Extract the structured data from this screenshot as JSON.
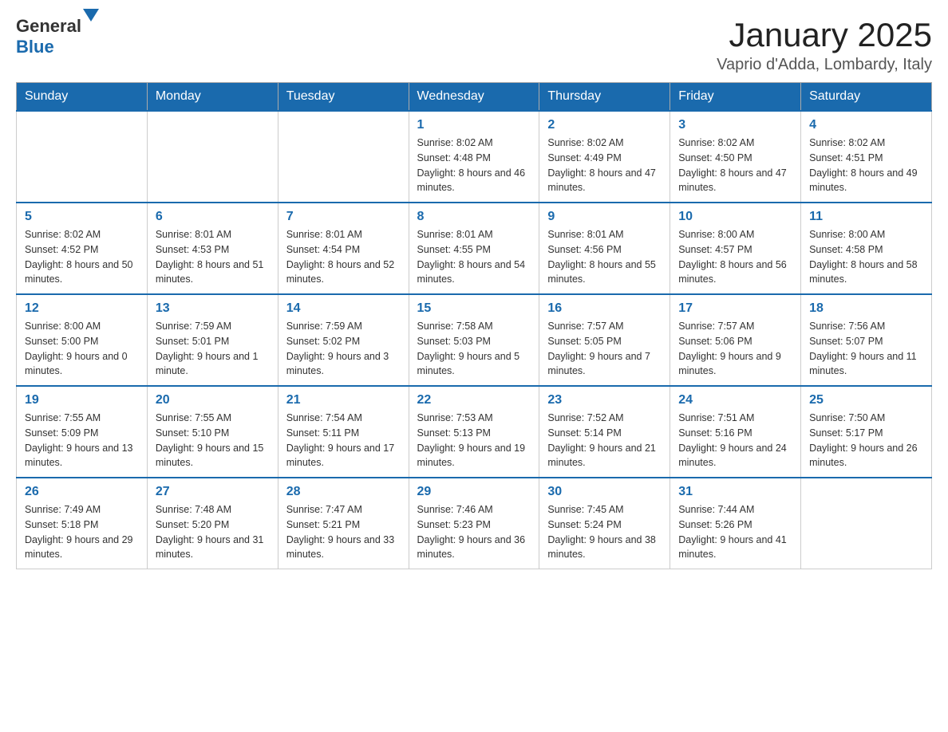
{
  "header": {
    "logo": {
      "general": "General",
      "blue": "Blue"
    },
    "title": "January 2025",
    "location": "Vaprio d'Adda, Lombardy, Italy"
  },
  "days_of_week": [
    "Sunday",
    "Monday",
    "Tuesday",
    "Wednesday",
    "Thursday",
    "Friday",
    "Saturday"
  ],
  "weeks": [
    [
      {
        "day": "",
        "sunrise": "",
        "sunset": "",
        "daylight": ""
      },
      {
        "day": "",
        "sunrise": "",
        "sunset": "",
        "daylight": ""
      },
      {
        "day": "",
        "sunrise": "",
        "sunset": "",
        "daylight": ""
      },
      {
        "day": "1",
        "sunrise": "Sunrise: 8:02 AM",
        "sunset": "Sunset: 4:48 PM",
        "daylight": "Daylight: 8 hours and 46 minutes."
      },
      {
        "day": "2",
        "sunrise": "Sunrise: 8:02 AM",
        "sunset": "Sunset: 4:49 PM",
        "daylight": "Daylight: 8 hours and 47 minutes."
      },
      {
        "day": "3",
        "sunrise": "Sunrise: 8:02 AM",
        "sunset": "Sunset: 4:50 PM",
        "daylight": "Daylight: 8 hours and 47 minutes."
      },
      {
        "day": "4",
        "sunrise": "Sunrise: 8:02 AM",
        "sunset": "Sunset: 4:51 PM",
        "daylight": "Daylight: 8 hours and 49 minutes."
      }
    ],
    [
      {
        "day": "5",
        "sunrise": "Sunrise: 8:02 AM",
        "sunset": "Sunset: 4:52 PM",
        "daylight": "Daylight: 8 hours and 50 minutes."
      },
      {
        "day": "6",
        "sunrise": "Sunrise: 8:01 AM",
        "sunset": "Sunset: 4:53 PM",
        "daylight": "Daylight: 8 hours and 51 minutes."
      },
      {
        "day": "7",
        "sunrise": "Sunrise: 8:01 AM",
        "sunset": "Sunset: 4:54 PM",
        "daylight": "Daylight: 8 hours and 52 minutes."
      },
      {
        "day": "8",
        "sunrise": "Sunrise: 8:01 AM",
        "sunset": "Sunset: 4:55 PM",
        "daylight": "Daylight: 8 hours and 54 minutes."
      },
      {
        "day": "9",
        "sunrise": "Sunrise: 8:01 AM",
        "sunset": "Sunset: 4:56 PM",
        "daylight": "Daylight: 8 hours and 55 minutes."
      },
      {
        "day": "10",
        "sunrise": "Sunrise: 8:00 AM",
        "sunset": "Sunset: 4:57 PM",
        "daylight": "Daylight: 8 hours and 56 minutes."
      },
      {
        "day": "11",
        "sunrise": "Sunrise: 8:00 AM",
        "sunset": "Sunset: 4:58 PM",
        "daylight": "Daylight: 8 hours and 58 minutes."
      }
    ],
    [
      {
        "day": "12",
        "sunrise": "Sunrise: 8:00 AM",
        "sunset": "Sunset: 5:00 PM",
        "daylight": "Daylight: 9 hours and 0 minutes."
      },
      {
        "day": "13",
        "sunrise": "Sunrise: 7:59 AM",
        "sunset": "Sunset: 5:01 PM",
        "daylight": "Daylight: 9 hours and 1 minute."
      },
      {
        "day": "14",
        "sunrise": "Sunrise: 7:59 AM",
        "sunset": "Sunset: 5:02 PM",
        "daylight": "Daylight: 9 hours and 3 minutes."
      },
      {
        "day": "15",
        "sunrise": "Sunrise: 7:58 AM",
        "sunset": "Sunset: 5:03 PM",
        "daylight": "Daylight: 9 hours and 5 minutes."
      },
      {
        "day": "16",
        "sunrise": "Sunrise: 7:57 AM",
        "sunset": "Sunset: 5:05 PM",
        "daylight": "Daylight: 9 hours and 7 minutes."
      },
      {
        "day": "17",
        "sunrise": "Sunrise: 7:57 AM",
        "sunset": "Sunset: 5:06 PM",
        "daylight": "Daylight: 9 hours and 9 minutes."
      },
      {
        "day": "18",
        "sunrise": "Sunrise: 7:56 AM",
        "sunset": "Sunset: 5:07 PM",
        "daylight": "Daylight: 9 hours and 11 minutes."
      }
    ],
    [
      {
        "day": "19",
        "sunrise": "Sunrise: 7:55 AM",
        "sunset": "Sunset: 5:09 PM",
        "daylight": "Daylight: 9 hours and 13 minutes."
      },
      {
        "day": "20",
        "sunrise": "Sunrise: 7:55 AM",
        "sunset": "Sunset: 5:10 PM",
        "daylight": "Daylight: 9 hours and 15 minutes."
      },
      {
        "day": "21",
        "sunrise": "Sunrise: 7:54 AM",
        "sunset": "Sunset: 5:11 PM",
        "daylight": "Daylight: 9 hours and 17 minutes."
      },
      {
        "day": "22",
        "sunrise": "Sunrise: 7:53 AM",
        "sunset": "Sunset: 5:13 PM",
        "daylight": "Daylight: 9 hours and 19 minutes."
      },
      {
        "day": "23",
        "sunrise": "Sunrise: 7:52 AM",
        "sunset": "Sunset: 5:14 PM",
        "daylight": "Daylight: 9 hours and 21 minutes."
      },
      {
        "day": "24",
        "sunrise": "Sunrise: 7:51 AM",
        "sunset": "Sunset: 5:16 PM",
        "daylight": "Daylight: 9 hours and 24 minutes."
      },
      {
        "day": "25",
        "sunrise": "Sunrise: 7:50 AM",
        "sunset": "Sunset: 5:17 PM",
        "daylight": "Daylight: 9 hours and 26 minutes."
      }
    ],
    [
      {
        "day": "26",
        "sunrise": "Sunrise: 7:49 AM",
        "sunset": "Sunset: 5:18 PM",
        "daylight": "Daylight: 9 hours and 29 minutes."
      },
      {
        "day": "27",
        "sunrise": "Sunrise: 7:48 AM",
        "sunset": "Sunset: 5:20 PM",
        "daylight": "Daylight: 9 hours and 31 minutes."
      },
      {
        "day": "28",
        "sunrise": "Sunrise: 7:47 AM",
        "sunset": "Sunset: 5:21 PM",
        "daylight": "Daylight: 9 hours and 33 minutes."
      },
      {
        "day": "29",
        "sunrise": "Sunrise: 7:46 AM",
        "sunset": "Sunset: 5:23 PM",
        "daylight": "Daylight: 9 hours and 36 minutes."
      },
      {
        "day": "30",
        "sunrise": "Sunrise: 7:45 AM",
        "sunset": "Sunset: 5:24 PM",
        "daylight": "Daylight: 9 hours and 38 minutes."
      },
      {
        "day": "31",
        "sunrise": "Sunrise: 7:44 AM",
        "sunset": "Sunset: 5:26 PM",
        "daylight": "Daylight: 9 hours and 41 minutes."
      },
      {
        "day": "",
        "sunrise": "",
        "sunset": "",
        "daylight": ""
      }
    ]
  ]
}
